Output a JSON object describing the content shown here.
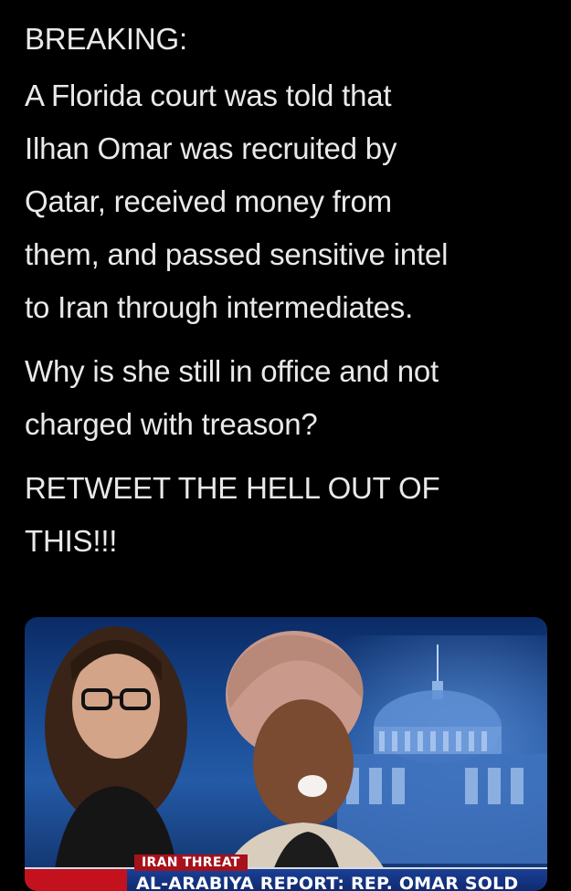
{
  "tweet": {
    "paragraphs": [
      "BREAKING:",
      "A Florida court was told that\nIlhan Omar was recruited by\nQatar, received money from\nthem, and passed sensitive intel\nto Iran through intermediates.",
      "Why is she still in office and not\ncharged with treason?",
      "RETWEET THE HELL OUT OF\nTHIS!!!"
    ]
  },
  "media": {
    "chyron_tag": "IRAN THREAT",
    "chyron_headline": "AL-ARABIYA REPORT: REP. OMAR SOLD",
    "colors": {
      "background": "#000000",
      "text": "#e9e9e9",
      "chyron_red": "#a7111b",
      "chyron_blue": "#1b3f95"
    }
  }
}
